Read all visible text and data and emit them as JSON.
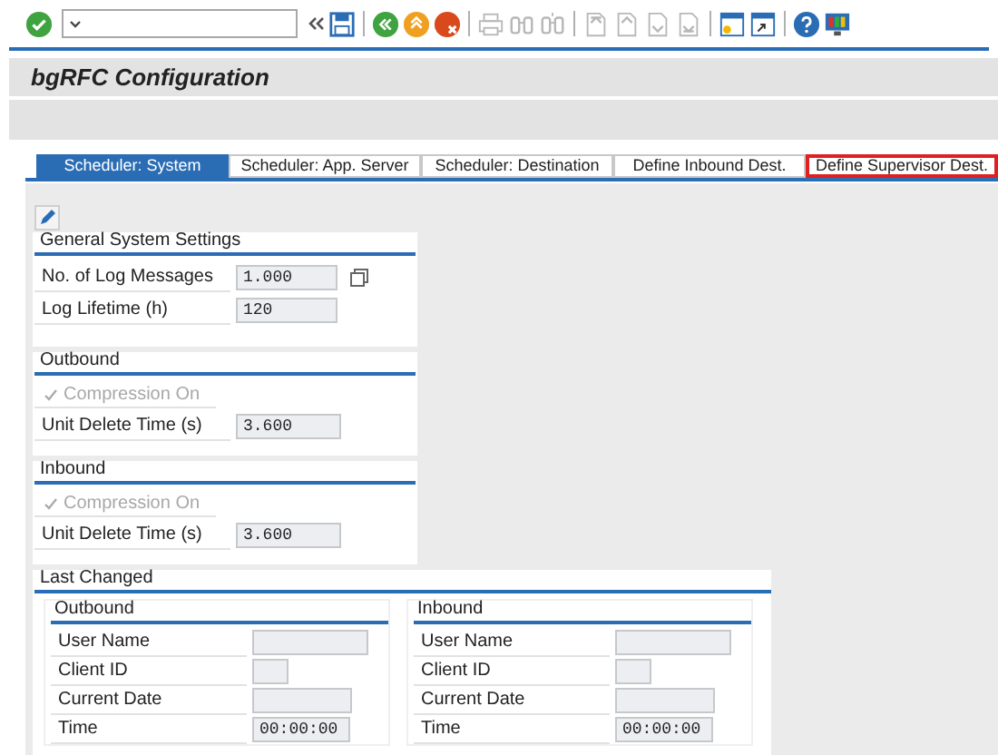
{
  "toolbar": {
    "buttons": [
      {
        "kind": "enter",
        "disabled": false
      },
      {
        "kind": "collapse",
        "disabled": false
      },
      {
        "kind": "save",
        "disabled": false
      },
      {
        "kind": "back",
        "disabled": false
      },
      {
        "kind": "exit",
        "disabled": false
      },
      {
        "kind": "cancel",
        "disabled": false
      },
      {
        "kind": "print",
        "disabled": true
      },
      {
        "kind": "find",
        "disabled": true
      },
      {
        "kind": "find-next",
        "disabled": true
      },
      {
        "kind": "first-page",
        "disabled": true
      },
      {
        "kind": "previous-page",
        "disabled": true
      },
      {
        "kind": "next-page",
        "disabled": true
      },
      {
        "kind": "last-page",
        "disabled": true
      },
      {
        "kind": "new-session",
        "disabled": false
      },
      {
        "kind": "shortcut",
        "disabled": false
      },
      {
        "kind": "help",
        "disabled": false
      },
      {
        "kind": "layout",
        "disabled": false
      }
    ]
  },
  "title": "bgRFC Configuration",
  "tabs": [
    {
      "label": "Scheduler: System",
      "selected": true,
      "focused": false
    },
    {
      "label": "Scheduler: App. Server",
      "selected": false,
      "focused": false
    },
    {
      "label": "Scheduler: Destination",
      "selected": false,
      "focused": false
    },
    {
      "label": "Define Inbound Dest.",
      "selected": false,
      "focused": false
    },
    {
      "label": "Define Supervisor Dest.",
      "selected": false,
      "focused": true
    }
  ],
  "general": {
    "title": "General System Settings",
    "rows": [
      {
        "label": "No. of Log Messages",
        "value": "1.000",
        "value_help": true
      },
      {
        "label": "Log Lifetime (h)",
        "value": "120",
        "value_help": false
      }
    ]
  },
  "outbound": {
    "title": "Outbound",
    "checkbox": {
      "label": "Compression On",
      "checked": true,
      "disabled": true
    },
    "field": {
      "label": "Unit Delete Time (s)",
      "value": "3.600"
    }
  },
  "inbound": {
    "title": "Inbound",
    "checkbox": {
      "label": "Compression On",
      "checked": true,
      "disabled": true
    },
    "field": {
      "label": "Unit Delete Time (s)",
      "value": "3.600"
    }
  },
  "last_changed": {
    "title": "Last Changed",
    "groups": [
      {
        "title": "Outbound",
        "rows": [
          {
            "label": "User Name",
            "kind": "long"
          },
          {
            "label": "Client ID",
            "kind": "short"
          },
          {
            "label": "Current Date",
            "kind": "medium"
          },
          {
            "label": "Time",
            "value": "00:00:00",
            "kind": "time"
          }
        ]
      },
      {
        "title": "Inbound",
        "rows": [
          {
            "label": "User Name",
            "kind": "long"
          },
          {
            "label": "Client ID",
            "kind": "short"
          },
          {
            "label": "Current Date",
            "kind": "medium"
          },
          {
            "label": "Time",
            "value": "00:00:00",
            "kind": "time"
          }
        ]
      }
    ]
  }
}
